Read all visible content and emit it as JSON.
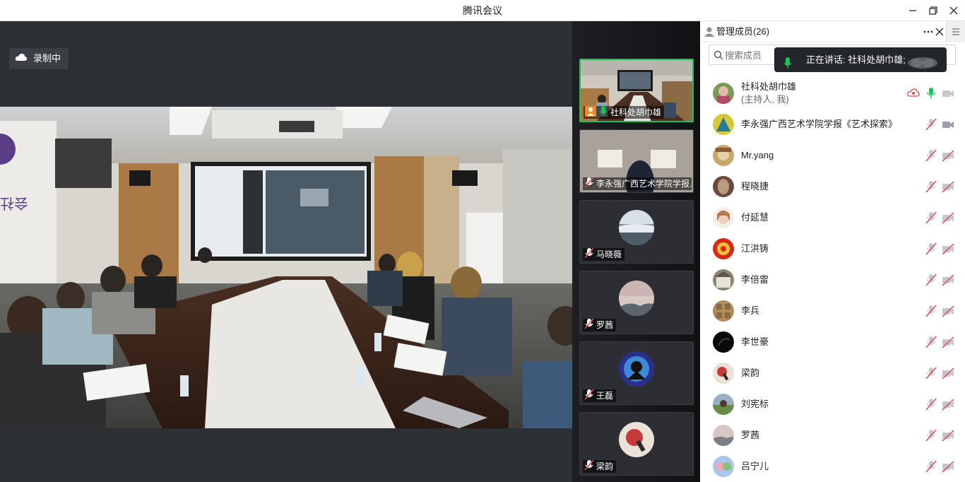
{
  "window": {
    "title": "腾讯会议",
    "minimize_icon": "minimize-icon",
    "restore_icon": "restore-icon",
    "close_icon": "close-icon"
  },
  "stage": {
    "recording_label": "录制中",
    "recording_icon": "cloud-icon"
  },
  "thumbnails": [
    {
      "name": "社科处胡巾雄",
      "active": true,
      "mic": "on"
    },
    {
      "name": "李永强广西艺术学院学报...",
      "active": false,
      "mic": "off"
    },
    {
      "name": "马晓薇",
      "active": false,
      "mic": "off"
    },
    {
      "name": "罗茜",
      "active": false,
      "mic": "off"
    },
    {
      "name": "王磊",
      "active": false,
      "mic": "off"
    },
    {
      "name": "梁韵",
      "active": false,
      "mic": "off"
    }
  ],
  "panel": {
    "title": "管理成员(26)",
    "search_placeholder": "搜索成员",
    "speaking_text": "正在讲话: 社科处胡巾雄;",
    "host_role": "(主持人, 我)",
    "members": [
      {
        "name": "社科处胡巾雄",
        "mic": "on",
        "video": "off"
      },
      {
        "name": "李永强广西艺术学院学报《艺术探索》",
        "mic": "off",
        "video": "on"
      },
      {
        "name": "Mr.yang",
        "mic": "off",
        "video": "off"
      },
      {
        "name": "程晓捷",
        "mic": "off",
        "video": "off"
      },
      {
        "name": "付延慧",
        "mic": "off",
        "video": "off"
      },
      {
        "name": "江洪铸",
        "mic": "off",
        "video": "off"
      },
      {
        "name": "李倍雷",
        "mic": "off",
        "video": "off"
      },
      {
        "name": "李兵",
        "mic": "off",
        "video": "off"
      },
      {
        "name": "李世豪",
        "mic": "off",
        "video": "off"
      },
      {
        "name": "梁韵",
        "mic": "off",
        "video": "off"
      },
      {
        "name": "刘宪标",
        "mic": "off",
        "video": "off"
      },
      {
        "name": "罗茜",
        "mic": "off",
        "video": "off"
      },
      {
        "name": "吕宁儿",
        "mic": "off",
        "video": "off"
      }
    ]
  },
  "colors": {
    "accent_green": "#1fbf5b",
    "muted_red": "#e5484d",
    "stage_bg": "#2c2f34"
  }
}
